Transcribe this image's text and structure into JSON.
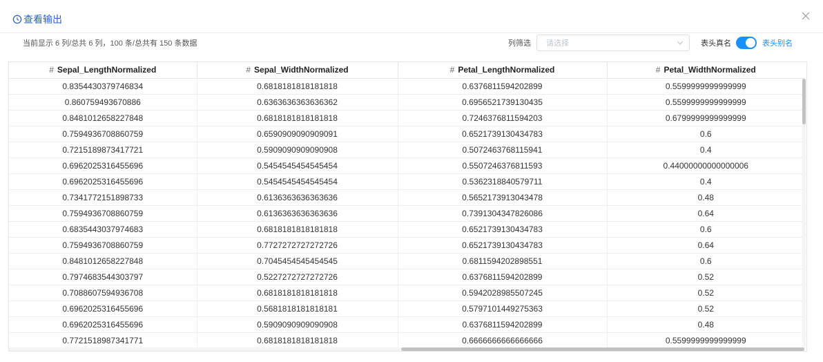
{
  "header": {
    "title": "查看输出",
    "icon": "clock-icon",
    "close_icon": "close-icon",
    "accent_color": "#2b62c9"
  },
  "toolbar": {
    "summary": "当前显示 6 列/总共 6 列，100 条/总共有 150 条数据",
    "filter_label": "列筛选",
    "filter_placeholder": "请选择",
    "real_name_label": "表头真名",
    "alias_label": "表头别名",
    "toggle_on": true,
    "toggle_color": "#1890ff"
  },
  "table": {
    "columns": [
      {
        "prefix": "#",
        "label": "Sepal_LengthNormalized"
      },
      {
        "prefix": "#",
        "label": "Sepal_WidthNormalized"
      },
      {
        "prefix": "#",
        "label": "Petal_LengthNormalized"
      },
      {
        "prefix": "#",
        "label": "Petal_WidthNormalized"
      }
    ],
    "rows": [
      [
        "0.8354430379746834",
        "0.6818181818181818",
        "0.6376811594202899",
        "0.5599999999999999"
      ],
      [
        "0.860759493670886",
        "0.6363636363636362",
        "0.6956521739130435",
        "0.5599999999999999"
      ],
      [
        "0.8481012658227848",
        "0.6818181818181818",
        "0.7246376811594203",
        "0.6799999999999999"
      ],
      [
        "0.7594936708860759",
        "0.6590909090909091",
        "0.6521739130434783",
        "0.6"
      ],
      [
        "0.7215189873417721",
        "0.5909090909090908",
        "0.5072463768115941",
        "0.4"
      ],
      [
        "0.6962025316455696",
        "0.5454545454545454",
        "0.5507246376811593",
        "0.44000000000000006"
      ],
      [
        "0.6962025316455696",
        "0.5454545454545454",
        "0.5362318840579711",
        "0.4"
      ],
      [
        "0.7341772151898733",
        "0.6136363636363636",
        "0.5652173913043478",
        "0.48"
      ],
      [
        "0.7594936708860759",
        "0.6136363636363636",
        "0.7391304347826086",
        "0.64"
      ],
      [
        "0.6835443037974683",
        "0.6818181818181818",
        "0.6521739130434783",
        "0.6"
      ],
      [
        "0.7594936708860759",
        "0.7727272727272726",
        "0.6521739130434783",
        "0.64"
      ],
      [
        "0.8481012658227848",
        "0.7045454545454545",
        "0.6811594202898551",
        "0.6"
      ],
      [
        "0.7974683544303797",
        "0.5227272727272726",
        "0.6376811594202899",
        "0.52"
      ],
      [
        "0.7088607594936708",
        "0.6818181818181818",
        "0.5942028985507245",
        "0.52"
      ],
      [
        "0.6962025316455696",
        "0.5681818181818181",
        "0.5797101449275363",
        "0.52"
      ],
      [
        "0.6962025316455696",
        "0.5909090909090908",
        "0.6376811594202899",
        "0.48"
      ],
      [
        "0.7721518987341771",
        "0.6818181818181818",
        "0.6666666666666666",
        "0.5599999999999999"
      ]
    ]
  }
}
